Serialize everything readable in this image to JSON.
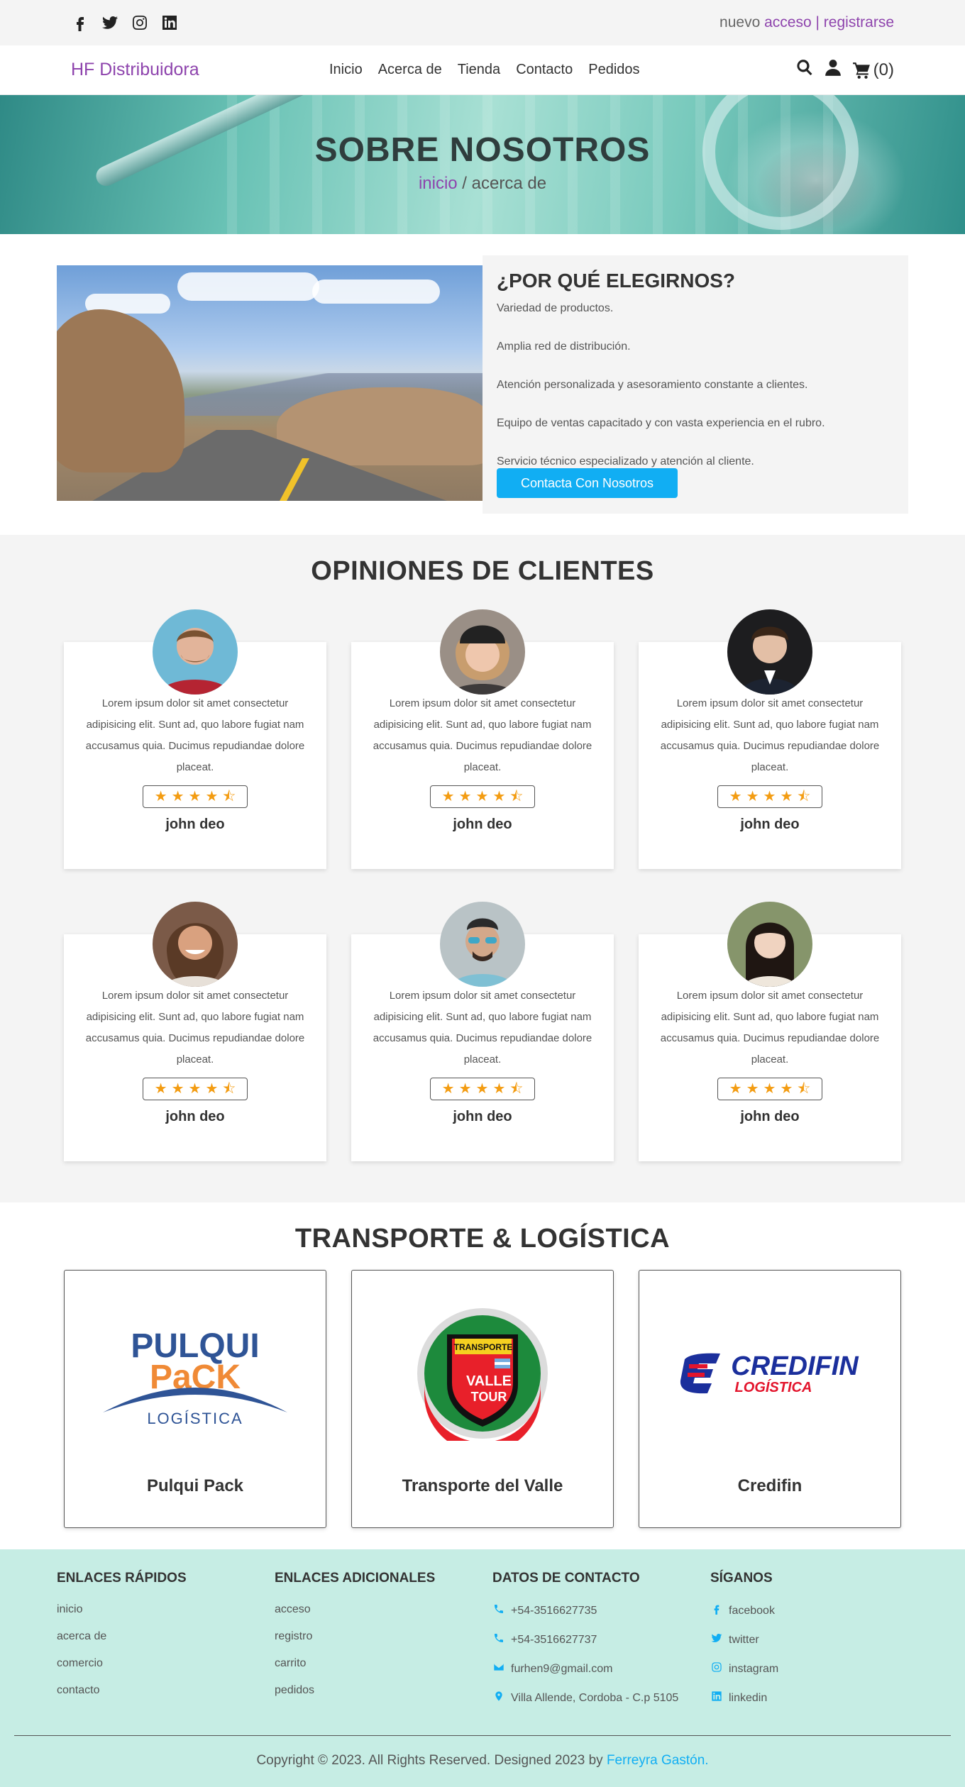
{
  "topbar": {
    "icons": [
      "facebook-icon",
      "twitter-icon",
      "instagram-icon",
      "linkedin-icon"
    ],
    "login_prefix": "nuevo",
    "login_link": "acceso",
    "separator": "|",
    "register_link": "registrarse"
  },
  "navbar": {
    "brand": "HF Distribuidora",
    "links": [
      "Inicio",
      "Acerca de",
      "Tienda",
      "Contacto",
      "Pedidos"
    ],
    "cart_count": "(0)"
  },
  "hero": {
    "title": "SOBRE NOSOTROS",
    "crumb_home": "inicio",
    "crumb_sep": " / ",
    "crumb_current": "acerca de"
  },
  "why": {
    "title": "¿POR QUÉ ELEGIRNOS?",
    "items": [
      "Variedad de productos.",
      "Amplia red de distribución.",
      "Atención personalizada y asesoramiento constante a clientes.",
      "Equipo de ventas capacitado y con vasta experiencia en el rubro.",
      "Servicio técnico especializado y atención al cliente."
    ],
    "button": "Contacta Con Nosotros"
  },
  "opinions": {
    "title": "OPINIONES DE CLIENTES",
    "reviews": [
      {
        "text": "Lorem ipsum dolor sit amet consectetur adipisicing elit. Sunt ad, quo labore fugiat nam accusamus quia. Ducimus repudiandae dolore placeat.",
        "name": "john deo",
        "rating": 4.5
      },
      {
        "text": "Lorem ipsum dolor sit amet consectetur adipisicing elit. Sunt ad, quo labore fugiat nam accusamus quia. Ducimus repudiandae dolore placeat.",
        "name": "john deo",
        "rating": 4.5
      },
      {
        "text": "Lorem ipsum dolor sit amet consectetur adipisicing elit. Sunt ad, quo labore fugiat nam accusamus quia. Ducimus repudiandae dolore placeat.",
        "name": "john deo",
        "rating": 4.5
      },
      {
        "text": "Lorem ipsum dolor sit amet consectetur adipisicing elit. Sunt ad, quo labore fugiat nam accusamus quia. Ducimus repudiandae dolore placeat.",
        "name": "john deo",
        "rating": 4.5
      },
      {
        "text": "Lorem ipsum dolor sit amet consectetur adipisicing elit. Sunt ad, quo labore fugiat nam accusamus quia. Ducimus repudiandae dolore placeat.",
        "name": "john deo",
        "rating": 4.5
      },
      {
        "text": "Lorem ipsum dolor sit amet consectetur adipisicing elit. Sunt ad, quo labore fugiat nam accusamus quia. Ducimus repudiandae dolore placeat.",
        "name": "john deo",
        "rating": 4.5
      }
    ]
  },
  "transport": {
    "title": "TRANSPORTE & LOGÍSTICA",
    "companies": [
      {
        "name": "Pulqui Pack",
        "logo_line1": "PULQUI",
        "logo_line2": "PaCK",
        "logo_line3": "LOGÍSTICA"
      },
      {
        "name": "Transporte del Valle",
        "logo_line1": "TRANSPORTE",
        "logo_line2": "VALLE",
        "logo_line3": "TOUR"
      },
      {
        "name": "Credifin",
        "logo_line1": "CREDIFIN",
        "logo_line2": "LOGÍSTICA"
      }
    ]
  },
  "footer": {
    "col1": {
      "title": "ENLACES RÁPIDOS",
      "links": [
        "inicio",
        "acerca de",
        "comercio",
        "contacto"
      ]
    },
    "col2": {
      "title": "ENLACES ADICIONALES",
      "links": [
        "acceso",
        "registro",
        "carrito",
        "pedidos"
      ]
    },
    "col3": {
      "title": "DATOS DE CONTACTO",
      "items": [
        "+54-3516627735",
        "+54-3516627737",
        "furhen9@gmail.com",
        "Villa Allende, Cordoba - C.p 5105"
      ]
    },
    "col4": {
      "title": "SÍGANOS",
      "items": [
        "facebook",
        "twitter",
        "instagram",
        "linkedin"
      ]
    },
    "copyright": "Copyright © 2023. All Rights Reserved. Designed 2023 by",
    "author": "Ferreyra Gastón."
  },
  "colors": {
    "brand": "#8e44ad",
    "accent": "#11aef3",
    "star": "#f39c12",
    "footer_bg": "#c6ede4"
  }
}
